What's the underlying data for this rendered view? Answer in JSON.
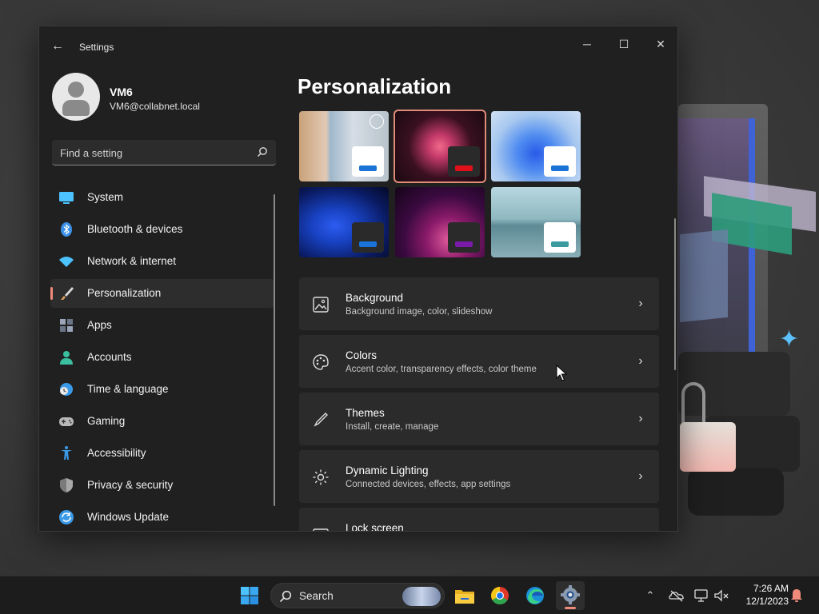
{
  "window": {
    "title": "Settings",
    "controls": {
      "minimize": "─",
      "maximize": "☐",
      "close": "✕"
    },
    "back": "←"
  },
  "profile": {
    "name": "VM6",
    "email": "VM6@collabnet.local"
  },
  "search": {
    "placeholder": "Find a setting"
  },
  "sidebar": {
    "items": [
      {
        "label": "System",
        "icon": "system-icon",
        "color": "#4cc2ff"
      },
      {
        "label": "Bluetooth & devices",
        "icon": "bluetooth-icon",
        "color": "#3a8fe8"
      },
      {
        "label": "Network & internet",
        "icon": "wifi-icon",
        "color": "#4cc2ff"
      },
      {
        "label": "Personalization",
        "icon": "brush-icon",
        "color": "#e0a060",
        "active": true
      },
      {
        "label": "Apps",
        "icon": "apps-icon",
        "color": "#9aa6b8"
      },
      {
        "label": "Accounts",
        "icon": "accounts-icon",
        "color": "#3ac0a0"
      },
      {
        "label": "Time & language",
        "icon": "globe-clock-icon",
        "color": "#3a9ae8"
      },
      {
        "label": "Gaming",
        "icon": "gamepad-icon",
        "color": "#b8b8b8"
      },
      {
        "label": "Accessibility",
        "icon": "accessibility-icon",
        "color": "#3a9ae8"
      },
      {
        "label": "Privacy & security",
        "icon": "shield-icon",
        "color": "#a8a8a8"
      },
      {
        "label": "Windows Update",
        "icon": "update-icon",
        "color": "#3a9ae8"
      }
    ]
  },
  "main": {
    "title": "Personalization",
    "themes": [
      {
        "name": "theme-1",
        "accent": "#1a73d6",
        "swatch_bg": "#ffffff",
        "selected": false,
        "slideshow": true
      },
      {
        "name": "theme-2",
        "accent": "#e0101a",
        "swatch_bg": "#2a2a2a",
        "selected": true,
        "slideshow": false
      },
      {
        "name": "theme-3",
        "accent": "#1a73d6",
        "swatch_bg": "#ffffff",
        "selected": false,
        "slideshow": false
      },
      {
        "name": "theme-4",
        "accent": "#1a73d6",
        "swatch_bg": "#2a2a2a",
        "selected": false,
        "slideshow": false
      },
      {
        "name": "theme-5",
        "accent": "#7a1aa8",
        "swatch_bg": "#2a2a2a",
        "selected": false,
        "slideshow": false
      },
      {
        "name": "theme-6",
        "accent": "#3a9aa0",
        "swatch_bg": "#ffffff",
        "selected": false,
        "slideshow": false
      }
    ],
    "cards": [
      {
        "title": "Background",
        "subtitle": "Background image, color, slideshow",
        "icon": "image-icon"
      },
      {
        "title": "Colors",
        "subtitle": "Accent color, transparency effects, color theme",
        "icon": "palette-icon"
      },
      {
        "title": "Themes",
        "subtitle": "Install, create, manage",
        "icon": "pen-icon"
      },
      {
        "title": "Dynamic Lighting",
        "subtitle": "Connected devices, effects, app settings",
        "icon": "lighting-icon"
      },
      {
        "title": "Lock screen",
        "subtitle": "",
        "icon": "lock-screen-icon"
      }
    ]
  },
  "taskbar": {
    "search_label": "Search",
    "apps": [
      "start-icon",
      "file-explorer-icon",
      "chrome-icon",
      "edge-icon",
      "settings-icon"
    ],
    "tray": [
      "chevron-up-icon",
      "onedrive-icon",
      "network-icon",
      "volume-muted-icon"
    ],
    "clock": {
      "time": "7:26 AM",
      "date": "12/1/2023"
    },
    "notification_color": "#f08a7a"
  }
}
